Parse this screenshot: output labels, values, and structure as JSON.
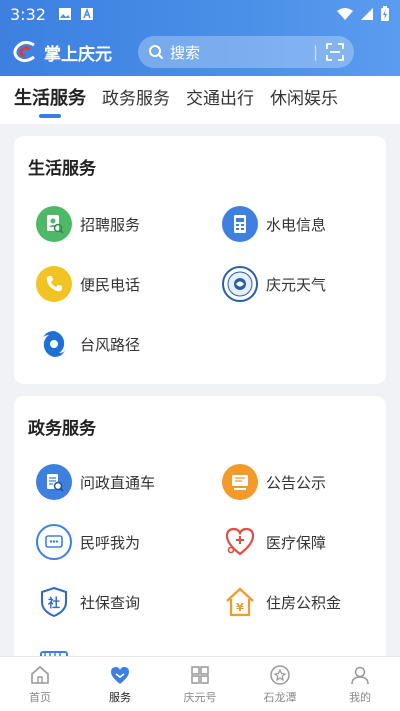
{
  "status_bar": {
    "time": "3:32"
  },
  "app": {
    "title": "掌上庆元"
  },
  "search": {
    "placeholder": "搜索",
    "separator": "|"
  },
  "tabs": [
    {
      "label": "生活服务",
      "active": true
    },
    {
      "label": "政务服务",
      "active": false
    },
    {
      "label": "交通出行",
      "active": false
    },
    {
      "label": "休闲娱乐",
      "active": false
    }
  ],
  "life_services": {
    "title": "生活服务",
    "items": [
      {
        "label": "招聘服务",
        "icon": "recruitment-icon"
      },
      {
        "label": "水电信息",
        "icon": "utility-info-icon"
      },
      {
        "label": "便民电话",
        "icon": "phone-icon"
      },
      {
        "label": "庆元天气",
        "icon": "weather-icon"
      },
      {
        "label": "台风路径",
        "icon": "typhoon-icon"
      }
    ]
  },
  "gov_services": {
    "title": "政务服务",
    "items": [
      {
        "label": "问政直通车",
        "icon": "inquiry-icon"
      },
      {
        "label": "公告公示",
        "icon": "announcement-icon"
      },
      {
        "label": "民呼我为",
        "icon": "message-icon"
      },
      {
        "label": "医疗保障",
        "icon": "medical-icon"
      },
      {
        "label": "社保查询",
        "icon": "social-security-icon"
      },
      {
        "label": "住房公积金",
        "icon": "housing-fund-icon"
      }
    ]
  },
  "bottom_nav": [
    {
      "label": "首页",
      "icon": "home-icon",
      "active": false
    },
    {
      "label": "服务",
      "icon": "service-heart-icon",
      "active": true
    },
    {
      "label": "庆元号",
      "icon": "grid-icon",
      "active": false
    },
    {
      "label": "石龙潭",
      "icon": "star-icon",
      "active": false
    },
    {
      "label": "我的",
      "icon": "profile-icon",
      "active": false
    }
  ],
  "colors": {
    "primary": "#3d80e0",
    "green": "#4cb868",
    "yellow": "#f2c423",
    "orange": "#f39a2b",
    "red": "#e14c44"
  }
}
